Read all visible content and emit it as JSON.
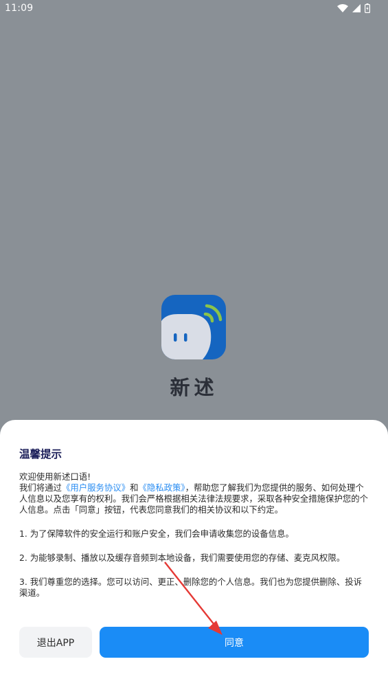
{
  "status_bar": {
    "time": "11:09",
    "icons": [
      "wifi-icon",
      "signal-icon",
      "battery-icon"
    ]
  },
  "splash": {
    "app_name": "新述",
    "icon": "app-logo-icon",
    "colors": {
      "overlay": "#8a9096",
      "logo_blue": "#1565c0",
      "logo_accent": "#8bc34a"
    }
  },
  "dialog": {
    "title": "温馨提示",
    "welcome": "欢迎使用新述口语!",
    "intro_before": "我们将通过",
    "user_agreement_link": "《用户服务协议》",
    "and": "和",
    "privacy_link": "《隐私政策》",
    "intro_after": "，帮助您了解我们为您提供的服务、如何处理个人信息以及您享有的权利。我们会严格根据相关法律法规要求，采取各种安全措施保护您的个人信息。点击「同意」按钮，代表您同意我们的相关协议和以下约定。",
    "item1": "1. 为了保障软件的安全运行和账户安全，我们会申请收集您的设备信息。",
    "item2": "2. 为能够录制、播放以及缓存音频到本地设备，我们需要使用您的存储、麦克风权限。",
    "item3": "3. 我们尊重您的选择。您可以访问、更正、删除您的个人信息。我们也为您提供删除、投诉渠道。",
    "exit_label": "退出APP",
    "agree_label": "同意",
    "colors": {
      "title": "#1c1f5a",
      "link": "#2a8df2",
      "primary": "#1a8cf6",
      "secondary_bg": "#f2f3f5",
      "annotation_arrow": "#e53935"
    }
  }
}
